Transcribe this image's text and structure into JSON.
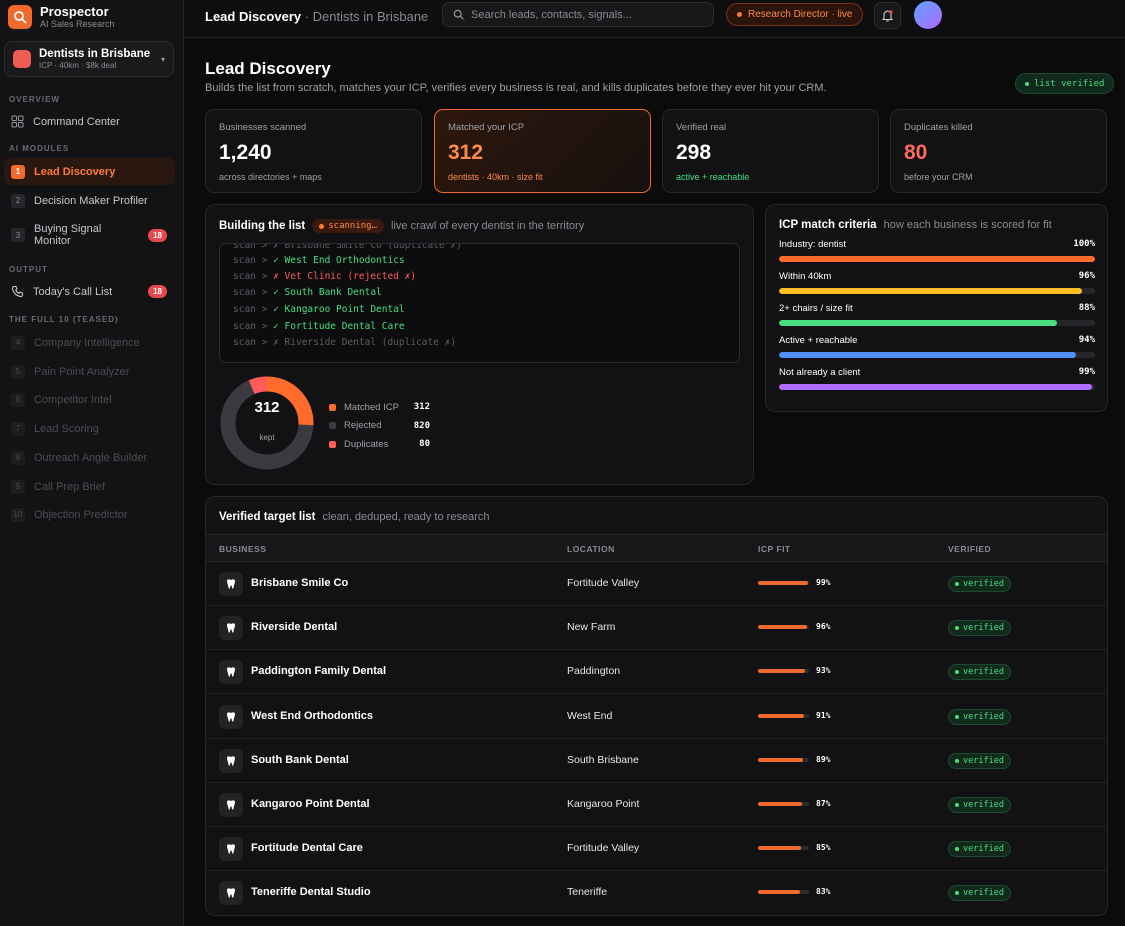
{
  "brand": {
    "name": "Prospector",
    "tagline": "AI Sales Research"
  },
  "workspace": {
    "name": "Dentists in Brisbane",
    "sub": "ICP · 40km · $8k deal"
  },
  "nav": {
    "overview_label": "OVERVIEW",
    "command_center": "Command Center",
    "ai_modules_label": "AI MODULES",
    "modules": [
      {
        "num": "1",
        "label": "Lead Discovery"
      },
      {
        "num": "2",
        "label": "Decision Maker Profiler"
      },
      {
        "num": "3",
        "label": "Buying Signal Monitor",
        "badge": "18"
      }
    ],
    "output_label": "OUTPUT",
    "call_list": {
      "label": "Today's Call List",
      "badge": "18"
    },
    "teased_label": "THE FULL 10 (TEASED)",
    "teased": [
      {
        "num": "4",
        "label": "Company Intelligence"
      },
      {
        "num": "5",
        "label": "Pain Point Analyzer"
      },
      {
        "num": "6",
        "label": "Competitor Intel"
      },
      {
        "num": "7",
        "label": "Lead Scoring"
      },
      {
        "num": "8",
        "label": "Outreach Angle Builder"
      },
      {
        "num": "9",
        "label": "Call Prep Brief"
      },
      {
        "num": "10",
        "label": "Objection Predictor"
      }
    ]
  },
  "topbar": {
    "title": "Lead Discovery",
    "separator": " · ",
    "subtitle": "Dentists in Brisbane",
    "search_placeholder": "Search leads, contacts, signals...",
    "role": "Research Director · live"
  },
  "header": {
    "title": "Lead Discovery",
    "subtitle": "Builds the list from scratch, matches your ICP, verifies every business is real, and kills duplicates before they ever hit your CRM.",
    "status": "list verified"
  },
  "stats": [
    {
      "label": "Businesses scanned",
      "value": "1,240",
      "foot": "across directories + maps"
    },
    {
      "label": "Matched your ICP",
      "value": "312",
      "foot": "dentists · 40km · size fit"
    },
    {
      "label": "Verified real",
      "value": "298",
      "foot": "active + reachable"
    },
    {
      "label": "Duplicates killed",
      "value": "80",
      "foot": "before your CRM"
    }
  ],
  "building": {
    "title": "Building the list",
    "status": "scanning…",
    "desc": "live crawl of every dentist in the territory",
    "prefix": "scan >",
    "log": [
      {
        "mark": "✗",
        "text": "Brisbane Smile Co (duplicate ✗)",
        "kind": "dup"
      },
      {
        "mark": "✓",
        "text": "West End Orthodontics",
        "kind": "ok"
      },
      {
        "mark": "✗",
        "text": "Vet Clinic (rejected ✗)",
        "kind": "rej"
      },
      {
        "mark": "✓",
        "text": "South Bank Dental",
        "kind": "ok"
      },
      {
        "mark": "✓",
        "text": "Kangaroo Point Dental",
        "kind": "ok"
      },
      {
        "mark": "✓",
        "text": "Fortitude Dental Care",
        "kind": "ok"
      },
      {
        "mark": "✗",
        "text": "Riverside Dental (duplicate ✗)",
        "kind": "dup"
      }
    ],
    "donut": {
      "center_value": "312",
      "center_label": "kept",
      "segments": [
        {
          "label": "Matched ICP",
          "value": 312,
          "display": "312",
          "color": "#ff6b2b"
        },
        {
          "label": "Rejected",
          "value": 820,
          "display": "820",
          "color": "#3a3a40"
        },
        {
          "label": "Duplicates",
          "value": 80,
          "display": "80",
          "color": "#ff5b5b"
        }
      ]
    }
  },
  "criteria": {
    "title": "ICP match criteria",
    "desc": "how each business is scored for fit",
    "items": [
      {
        "label": "Industry: dentist",
        "pct": "100%",
        "value": 100,
        "color": "#ff6b2b"
      },
      {
        "label": "Within 40km",
        "pct": "96%",
        "value": 96,
        "color": "#fbbf24"
      },
      {
        "label": "2+ chairs / size fit",
        "pct": "88%",
        "value": 88,
        "color": "#4ade80"
      },
      {
        "label": "Active + reachable",
        "pct": "94%",
        "value": 94,
        "color": "#4f8ff7"
      },
      {
        "label": "Not already a client",
        "pct": "99%",
        "value": 99,
        "color": "#b06cff"
      }
    ]
  },
  "targets": {
    "title": "Verified target list",
    "desc": "clean, deduped, ready to research",
    "columns": [
      "BUSINESS",
      "LOCATION",
      "ICP FIT",
      "VERIFIED"
    ],
    "status_label": "verified",
    "rows": [
      {
        "name": "Brisbane Smile Co",
        "location": "Fortitude Valley",
        "fit": "99%",
        "fit_value": 99
      },
      {
        "name": "Riverside Dental",
        "location": "New Farm",
        "fit": "96%",
        "fit_value": 96
      },
      {
        "name": "Paddington Family Dental",
        "location": "Paddington",
        "fit": "93%",
        "fit_value": 93
      },
      {
        "name": "West End Orthodontics",
        "location": "West End",
        "fit": "91%",
        "fit_value": 91
      },
      {
        "name": "South Bank Dental",
        "location": "South Brisbane",
        "fit": "89%",
        "fit_value": 89
      },
      {
        "name": "Kangaroo Point Dental",
        "location": "Kangaroo Point",
        "fit": "87%",
        "fit_value": 87
      },
      {
        "name": "Fortitude Dental Care",
        "location": "Fortitude Valley",
        "fit": "85%",
        "fit_value": 85
      },
      {
        "name": "Teneriffe Dental Studio",
        "location": "Teneriffe",
        "fit": "83%",
        "fit_value": 83
      }
    ]
  }
}
